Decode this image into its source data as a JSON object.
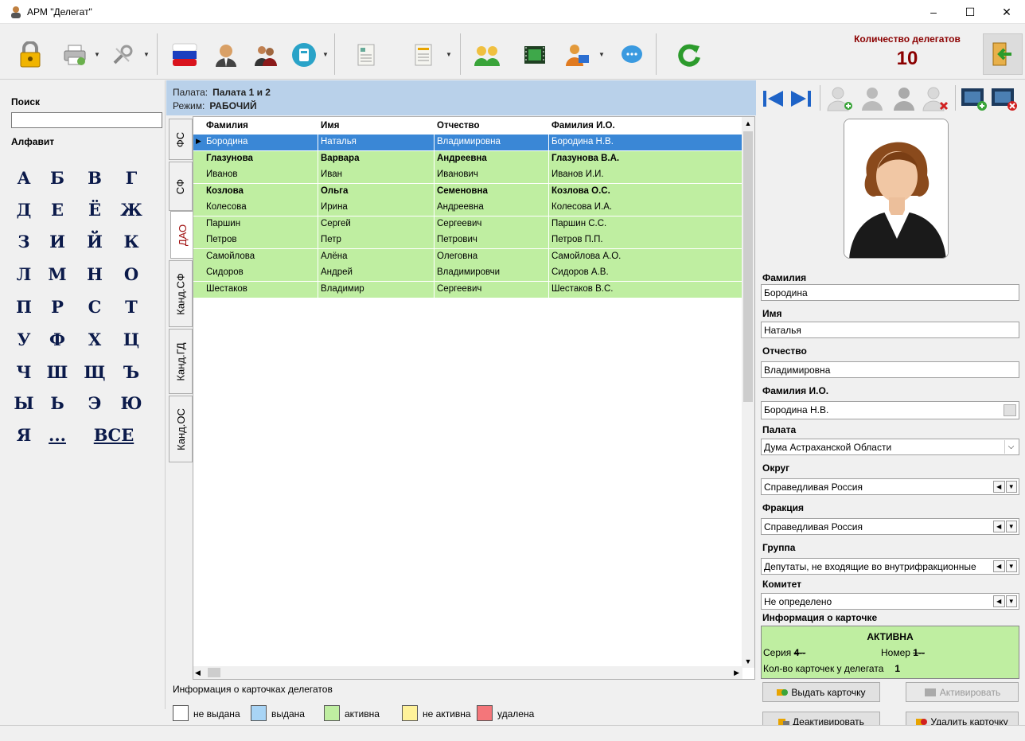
{
  "window": {
    "title": "АРМ \"Делегат\"",
    "minimize": "–",
    "maximize": "☐",
    "close": "✕"
  },
  "toolbar": {
    "count_title": "Количество делегатов",
    "count_value": "10"
  },
  "left": {
    "search_label": "Поиск",
    "search_value": "",
    "alphabet_label": "Алфавит",
    "letters": [
      "А",
      "Б",
      "В",
      "Г",
      "Д",
      "Е",
      "Ё",
      "Ж",
      "З",
      "И",
      "Й",
      "К",
      "Л",
      "М",
      "Н",
      "О",
      "П",
      "Р",
      "С",
      "Т",
      "У",
      "Ф",
      "Х",
      "Ц",
      "Ч",
      "Ш",
      "Щ",
      "Ъ",
      "Ы",
      "Ь",
      "Э",
      "Ю",
      "Я",
      "...",
      "ВСЕ"
    ]
  },
  "center": {
    "chamber_label": "Палата:",
    "chamber_value": "Палата 1 и 2",
    "mode_label": "Режим:",
    "mode_value": "РАБОЧИЙ",
    "tabs": [
      "ФС",
      "СФ",
      "ДАО",
      "Канд.СФ",
      "Канд.ГД",
      "Канд.ОС"
    ],
    "columns": [
      "Фамилия",
      "Имя",
      "Отчество",
      "Фамилия И.О."
    ],
    "rows": [
      [
        "Бородина",
        "Наталья",
        "Владимировна",
        "Бородина Н.В."
      ],
      [
        "Глазунова",
        "Варвара",
        "Андреевна",
        "Глазунова В.А."
      ],
      [
        "Иванов",
        "Иван",
        "Иванович",
        "Иванов И.И."
      ],
      [
        "Козлова",
        "Ольга",
        "Семеновна",
        "Козлова О.С."
      ],
      [
        "Колесова",
        "Ирина",
        "Андреевна",
        "Колесова И.А."
      ],
      [
        "Паршин",
        "Сергей",
        "Сергеевич",
        "Паршин С.С."
      ],
      [
        "Петров",
        "Петр",
        "Петрович",
        "Петров П.П."
      ],
      [
        "Самойлова",
        "Алёна",
        "Олеговна",
        "Самойлова А.О."
      ],
      [
        "Сидоров",
        "Андрей",
        "Владимировчи",
        "Сидоров А.В."
      ],
      [
        "Шестаков",
        "Владимир",
        "Сергеевич",
        "Шестаков В.С."
      ]
    ],
    "legend_title": "Информация о карточках делегатов",
    "legend": [
      {
        "label": "не выдана",
        "color": "#ffffff"
      },
      {
        "label": "выдана",
        "color": "#a8d4f5"
      },
      {
        "label": "активна",
        "color": "#bfeea1"
      },
      {
        "label": "не активна",
        "color": "#fff29a"
      },
      {
        "label": "удалена",
        "color": "#f4767a"
      }
    ]
  },
  "right": {
    "surname_label": "Фамилия",
    "surname": "Бородина",
    "name_label": "Имя",
    "name": "Наталья",
    "patronymic_label": "Отчество",
    "patronymic": "Владимировна",
    "short_label": "Фамилия И.О.",
    "short": "Бородина Н.В.",
    "chamber_label": "Палата",
    "chamber": "Дума Астраханской Области",
    "district_label": "Округ",
    "district": "Справедливая Россия",
    "faction_label": "Фракция",
    "faction": "Справедливая Россия",
    "group_label": "Группа",
    "group": "Депутаты, не входящие во внутрифракционные",
    "committee_label": "Комитет",
    "committee": "Не определено",
    "card_info_label": "Информация о карточке",
    "card_status": "АКТИВНА",
    "series_label": "Серия",
    "series_value": "4--",
    "number_label": "Номер",
    "number_value": "1--",
    "cards_count_label": "Кол-во карточек у делегата",
    "cards_count": "1",
    "btn_issue": "Выдать карточку",
    "btn_activate": "Активировать",
    "btn_deactivate": "Деактивировать",
    "btn_delete": "Удалить карточку"
  },
  "colors": {
    "accent_red": "#8b0000",
    "row_green": "#bfeea1",
    "row_selected": "#3a87d6",
    "header_blue": "#b9d1ea"
  }
}
